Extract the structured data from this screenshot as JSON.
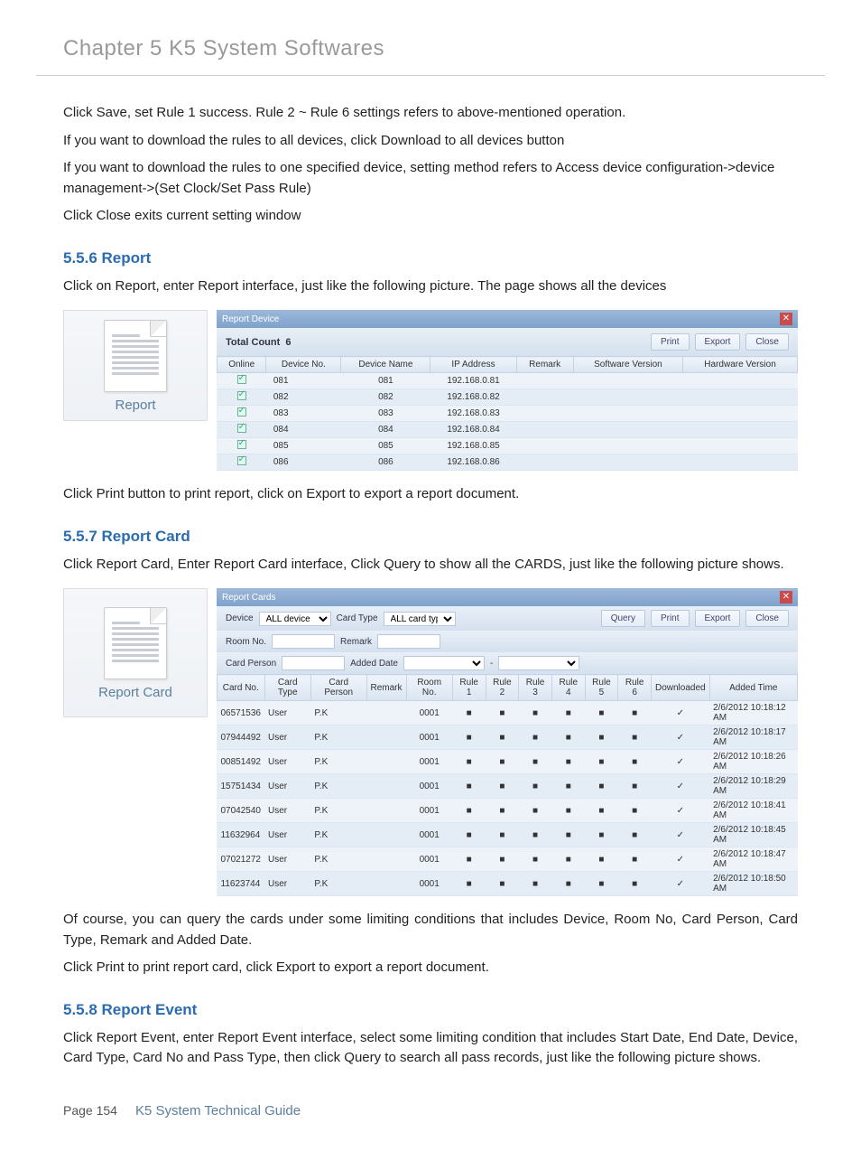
{
  "header": {
    "chapter": "Chapter 5    K5 System Softwares"
  },
  "intro": {
    "p1": "Click Save, set Rule 1 success. Rule 2 ~ Rule 6 settings refers to above-mentioned operation.",
    "p2": "If you want to download the rules to all devices, click Download to all devices button",
    "p3": "If you want to download the rules to one specified device, setting method refers to Access device configuration->device management->(Set Clock/Set Pass Rule)",
    "p4": "Click Close exits current setting window"
  },
  "s556": {
    "heading": "5.5.6 Report",
    "p1": "Click on Report, enter Report interface, just like the following picture. The page shows all the devices",
    "p2": "Click Print button to print report, click on Export to export a report document.",
    "iconLabel": "Report",
    "window": {
      "title": "Report Device",
      "totalLabel": "Total Count",
      "totalValue": "6",
      "buttons": {
        "print": "Print",
        "export": "Export",
        "close": "Close"
      },
      "cols": {
        "online": "Online",
        "devno": "Device No.",
        "devname": "Device Name",
        "ip": "IP Address",
        "remark": "Remark",
        "sw": "Software Version",
        "hw": "Hardware Version"
      },
      "rows": [
        {
          "no": "081",
          "name": "081",
          "ip": "192.168.0.81"
        },
        {
          "no": "082",
          "name": "082",
          "ip": "192.168.0.82"
        },
        {
          "no": "083",
          "name": "083",
          "ip": "192.168.0.83"
        },
        {
          "no": "084",
          "name": "084",
          "ip": "192.168.0.84"
        },
        {
          "no": "085",
          "name": "085",
          "ip": "192.168.0.85"
        },
        {
          "no": "086",
          "name": "086",
          "ip": "192.168.0.86"
        }
      ]
    }
  },
  "s557": {
    "heading": "5.5.7 Report Card",
    "p1": "Click Report Card, Enter Report Card interface, Click Query to show all the CARDS, just like the following picture shows.",
    "p2": "Of course, you can query the cards under some limiting conditions that includes Device, Room No, Card Person, Card Type, Remark and Added Date.",
    "p3": "Click Print to print report card, click Export to export a report document.",
    "iconLabel": "Report Card",
    "window": {
      "title": "Report Cards",
      "filters": {
        "device": "Device",
        "deviceVal": "ALL device",
        "cardType": "Card Type",
        "cardTypeVal": "ALL card type",
        "roomNo": "Room No.",
        "remark": "Remark",
        "cardPerson": "Card Person",
        "addedDate": "Added Date"
      },
      "buttons": {
        "query": "Query",
        "print": "Print",
        "export": "Export",
        "close": "Close"
      },
      "cols": {
        "cardno": "Card No.",
        "cardtype": "Card Type",
        "cardperson": "Card Person",
        "remark": "Remark",
        "roomno": "Room No.",
        "r1": "Rule 1",
        "r2": "Rule 2",
        "r3": "Rule 3",
        "r4": "Rule 4",
        "r5": "Rule 5",
        "r6": "Rule 6",
        "dl": "Downloaded",
        "added": "Added Time"
      },
      "rows": [
        {
          "cardno": "06571536",
          "type": "User",
          "person": "P.K",
          "room": "0001",
          "added": "2/6/2012 10:18:12 AM"
        },
        {
          "cardno": "07944492",
          "type": "User",
          "person": "P.K",
          "room": "0001",
          "added": "2/6/2012 10:18:17 AM"
        },
        {
          "cardno": "00851492",
          "type": "User",
          "person": "P.K",
          "room": "0001",
          "added": "2/6/2012 10:18:26 AM"
        },
        {
          "cardno": "15751434",
          "type": "User",
          "person": "P.K",
          "room": "0001",
          "added": "2/6/2012 10:18:29 AM"
        },
        {
          "cardno": "07042540",
          "type": "User",
          "person": "P.K",
          "room": "0001",
          "added": "2/6/2012 10:18:41 AM"
        },
        {
          "cardno": "11632964",
          "type": "User",
          "person": "P.K",
          "room": "0001",
          "added": "2/6/2012 10:18:45 AM"
        },
        {
          "cardno": "07021272",
          "type": "User",
          "person": "P.K",
          "room": "0001",
          "added": "2/6/2012 10:18:47 AM"
        },
        {
          "cardno": "11623744",
          "type": "User",
          "person": "P.K",
          "room": "0001",
          "added": "2/6/2012 10:18:50 AM"
        }
      ]
    }
  },
  "s558": {
    "heading": "5.5.8 Report Event",
    "p1": "Click Report Event, enter Report Event interface, select some limiting condition that includes Start Date, End Date, Device, Card Type, Card No and Pass Type, then click Query to search all pass records, just like the following picture shows."
  },
  "footer": {
    "page": "Page 154",
    "guide": "K5 System Technical Guide"
  }
}
